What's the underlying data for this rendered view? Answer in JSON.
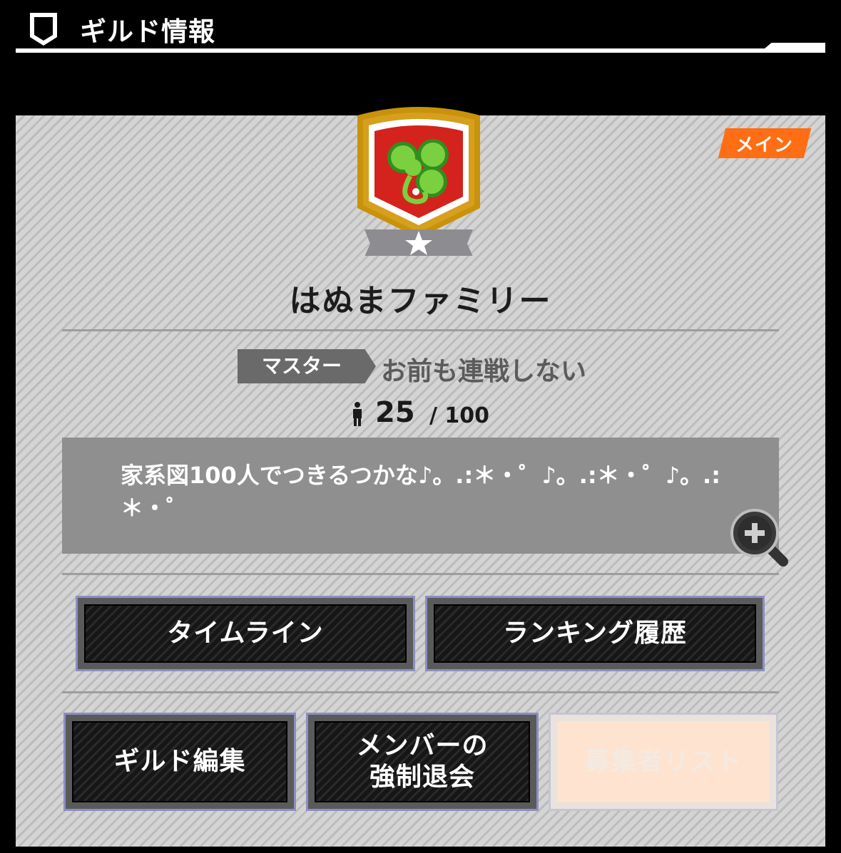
{
  "header": {
    "title": "ギルド情報"
  },
  "guild": {
    "name": "はぬまファミリー",
    "badge": "メイン",
    "master_label": "マスター",
    "master_name": "お前も連戦しない",
    "member_count": "25",
    "member_max": "/ 100",
    "description": "家系図100人でつきるつかな♪。.:＊・゜♪。.:＊・゜♪。.:＊・゜"
  },
  "buttons": {
    "timeline": "タイムライン",
    "ranking_history": "ランキング履歴",
    "guild_edit": "ギルド編集",
    "kick_member_line1": "メンバーの",
    "kick_member_line2": "強制退会",
    "recruit_list": "募集者リスト"
  },
  "colors": {
    "badge_orange": "#ff6e14",
    "emblem_gold": "#c9920b",
    "emblem_red": "#d4231c",
    "clover_green": "#6fc73a"
  },
  "icons": [
    "shield-icon",
    "guild-emblem-icon",
    "person-icon",
    "zoom-in-icon",
    "star-icon"
  ]
}
